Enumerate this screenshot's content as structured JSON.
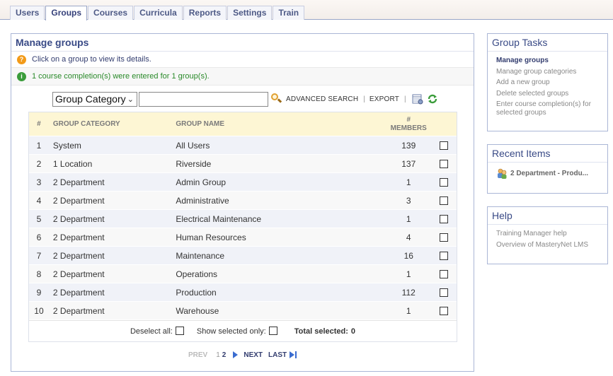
{
  "tabs": [
    {
      "label": "Users",
      "active": false
    },
    {
      "label": "Groups",
      "active": true
    },
    {
      "label": "Courses",
      "active": false
    },
    {
      "label": "Curricula",
      "active": false
    },
    {
      "label": "Reports",
      "active": false
    },
    {
      "label": "Settings",
      "active": false
    },
    {
      "label": "Train",
      "active": false
    }
  ],
  "main": {
    "title": "Manage groups",
    "help_text": "Click on a group to view its details.",
    "success_text": "1 course completion(s) were entered for 1 group(s).",
    "search": {
      "category_select": "Group Category",
      "input_value": "",
      "advanced_search": "ADVANCED SEARCH",
      "export": "EXPORT",
      "separator": "|"
    },
    "table": {
      "headers": {
        "num": "#",
        "category": "GROUP CATEGORY",
        "name": "GROUP NAME",
        "members_line1": "#",
        "members_line2": "MEMBERS"
      },
      "rows": [
        {
          "num": "1",
          "category": "System",
          "name": "All Users",
          "members": "139"
        },
        {
          "num": "2",
          "category": "1 Location",
          "name": "Riverside",
          "members": "137"
        },
        {
          "num": "3",
          "category": "2 Department",
          "name": "Admin Group",
          "members": "1"
        },
        {
          "num": "4",
          "category": "2 Department",
          "name": "Administrative",
          "members": "3"
        },
        {
          "num": "5",
          "category": "2 Department",
          "name": "Electrical Maintenance",
          "members": "1"
        },
        {
          "num": "6",
          "category": "2 Department",
          "name": "Human Resources",
          "members": "4"
        },
        {
          "num": "7",
          "category": "2 Department",
          "name": "Maintenance",
          "members": "16"
        },
        {
          "num": "8",
          "category": "2 Department",
          "name": "Operations",
          "members": "1"
        },
        {
          "num": "9",
          "category": "2 Department",
          "name": "Production",
          "members": "112"
        },
        {
          "num": "10",
          "category": "2 Department",
          "name": "Warehouse",
          "members": "1"
        }
      ],
      "footer": {
        "deselect_all": "Deselect all:",
        "show_selected_only": "Show selected only:",
        "total_selected_label": "Total selected:",
        "total_selected_value": "0"
      }
    },
    "pager": {
      "prev": "PREV",
      "page1": "1",
      "page2": "2",
      "next": "NEXT",
      "last": "LAST"
    }
  },
  "sidebar": {
    "tasks": {
      "title": "Group Tasks",
      "links": [
        "Manage groups",
        "Manage group categories",
        "Add a new group",
        "Delete selected groups",
        "Enter course completion(s) for selected groups"
      ]
    },
    "recent": {
      "title": "Recent Items",
      "item": "2 Department - Produ..."
    },
    "help": {
      "title": "Help",
      "links": [
        "Training Manager help",
        "Overview of MasteryNet LMS"
      ]
    }
  },
  "colors": {
    "accent": "#394a86",
    "header_bg": "#fdf6d4",
    "success": "#2a8a2a",
    "help_icon": "#f29a18"
  }
}
